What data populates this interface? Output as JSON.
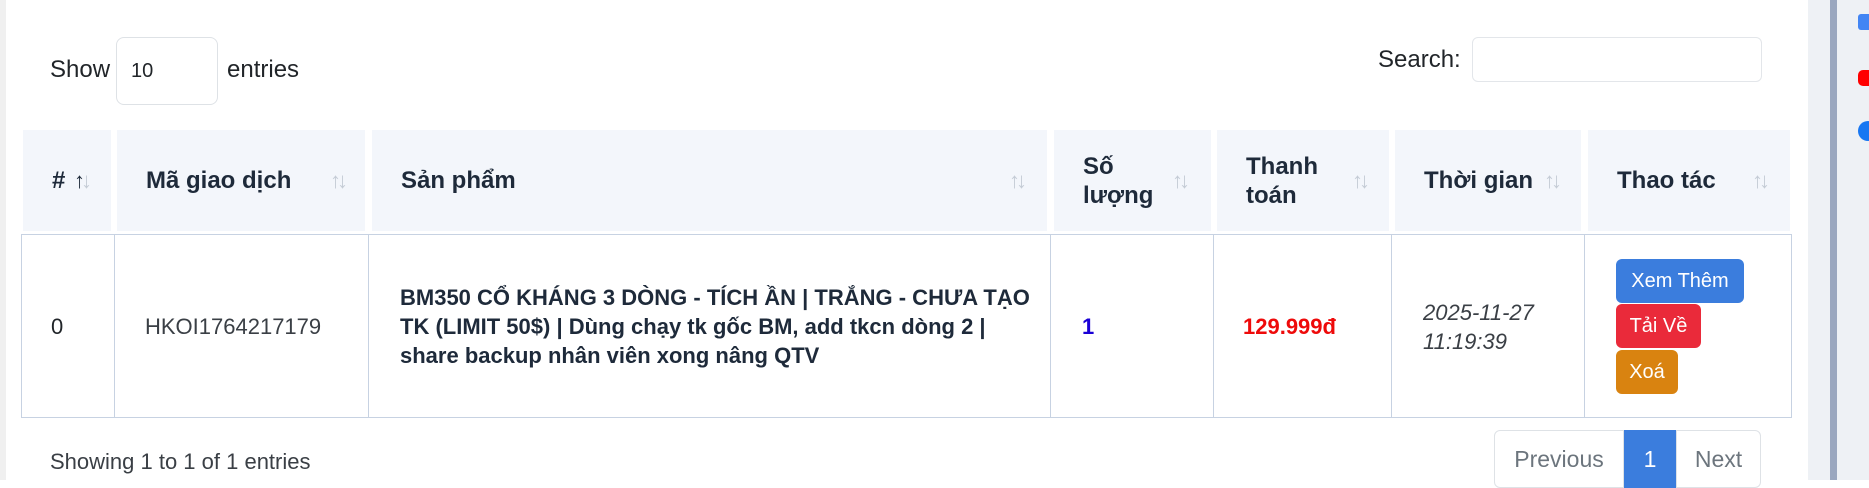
{
  "length_control": {
    "show_label": "Show",
    "value": "10",
    "entries_label": "entries"
  },
  "search": {
    "label": "Search:",
    "value": ""
  },
  "table": {
    "columns": [
      {
        "label": "#",
        "sort": "asc"
      },
      {
        "label": "Mã giao dịch",
        "sort": "none"
      },
      {
        "label": "Sản phẩm",
        "sort": "none"
      },
      {
        "label": "Số lượng",
        "sort": "none"
      },
      {
        "label": "Thanh toán",
        "sort": "none"
      },
      {
        "label": "Thời gian",
        "sort": "none"
      },
      {
        "label": "Thao tác",
        "sort": "none"
      }
    ],
    "rows": [
      {
        "index": "0",
        "transaction_code": "HKOI1764217179",
        "product": "BM350 CỔ KHÁNG 3 DÒNG - TÍCH ẦN | TRẮNG - CHƯA TẠO TK (LIMIT 50$) | Dùng chạy tk gốc BM, add tkcn dòng 2 | share backup nhân viên xong nâng QTV",
        "quantity": "1",
        "payment": "129.999đ",
        "time": "2025-11-27 11:19:39",
        "actions": {
          "view_more": "Xem Thêm",
          "download": "Tải Về",
          "delete": "Xoá"
        }
      }
    ]
  },
  "footer": {
    "info": "Showing 1 to 1 of 1 entries",
    "previous_label": "Previous",
    "current_page": "1",
    "next_label": "Next"
  },
  "colors": {
    "header_bg": "#f3f6fb",
    "quantity": "#1a00d6",
    "payment": "#ee0a0a",
    "view_more_button": "#3b7ddd",
    "download_button": "#ea2a3a",
    "delete_button": "#d98310",
    "active_page": "#3b7ddd"
  },
  "browser_sidebar_icons": [
    "google-icon",
    "youtube-icon",
    "facebook-icon"
  ]
}
